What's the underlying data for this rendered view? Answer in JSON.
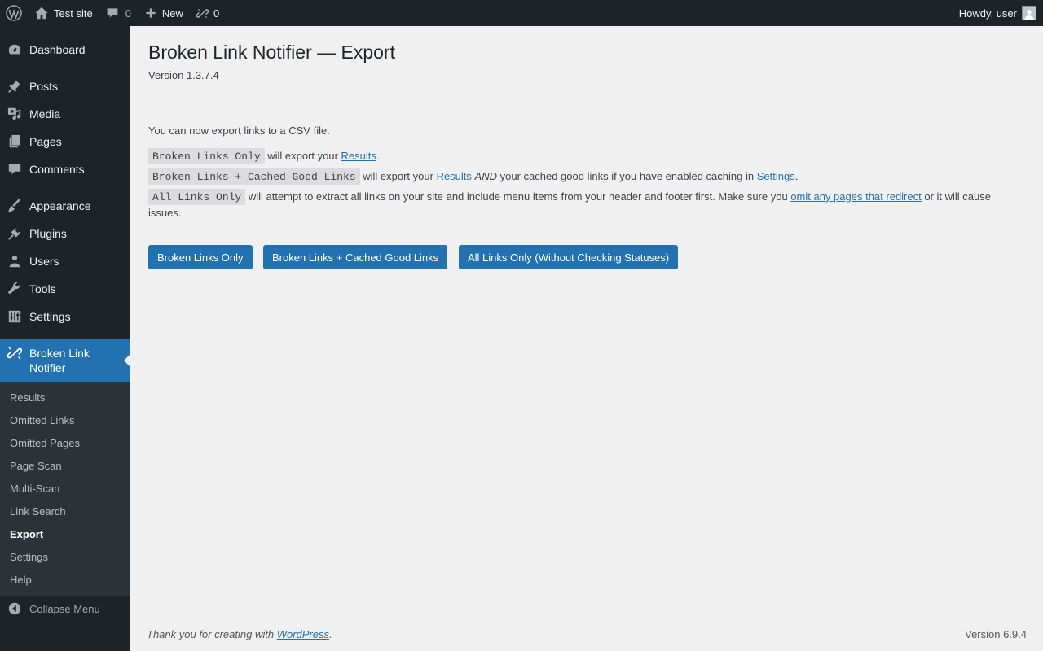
{
  "adminbar": {
    "site_name": "Test site",
    "comments_count": "0",
    "new_label": "New",
    "blf_count": "0",
    "howdy": "Howdy, user"
  },
  "sidebar": {
    "items": [
      {
        "label": "Dashboard",
        "icon": "dashboard-icon"
      },
      {
        "label": "Posts",
        "icon": "pin-icon"
      },
      {
        "label": "Media",
        "icon": "media-icon"
      },
      {
        "label": "Pages",
        "icon": "pages-icon"
      },
      {
        "label": "Comments",
        "icon": "comment-icon"
      },
      {
        "label": "Appearance",
        "icon": "brush-icon"
      },
      {
        "label": "Plugins",
        "icon": "plugin-icon"
      },
      {
        "label": "Users",
        "icon": "user-icon"
      },
      {
        "label": "Tools",
        "icon": "wrench-icon"
      },
      {
        "label": "Settings",
        "icon": "sliders-icon"
      },
      {
        "label": "Broken Link Notifier",
        "icon": "broken-link-icon"
      }
    ],
    "submenu": [
      "Results",
      "Omitted Links",
      "Omitted Pages",
      "Page Scan",
      "Multi-Scan",
      "Link Search",
      "Export",
      "Settings",
      "Help"
    ],
    "collapse": "Collapse Menu"
  },
  "main": {
    "title": "Broken Link Notifier — Export",
    "version": "Version 1.3.7.4",
    "intro": "You can now export links to a CSV file.",
    "line1": {
      "code": "Broken Links Only",
      "pre": " will export your ",
      "link": "Results",
      "post": "."
    },
    "line2": {
      "code": "Broken Links + Cached Good Links",
      "pre": " will export your ",
      "link": "Results",
      "em": "AND",
      "mid": " your cached good links if you have enabled caching in ",
      "link2": "Settings",
      "post": "."
    },
    "line3": {
      "code": "All Links Only",
      "pre": " will attempt to extract all links on your site and include menu items from your header and footer first. Make sure you ",
      "link": "omit any pages that redirect",
      "post": " or it will cause issues."
    },
    "buttons": [
      "Broken Links Only",
      "Broken Links + Cached Good Links",
      "All Links Only (Without Checking Statuses)"
    ]
  },
  "footer": {
    "thanks": "Thank you for creating with ",
    "wp_link": "WordPress",
    "thanks_end": ".",
    "version": "Version 6.9.4"
  }
}
